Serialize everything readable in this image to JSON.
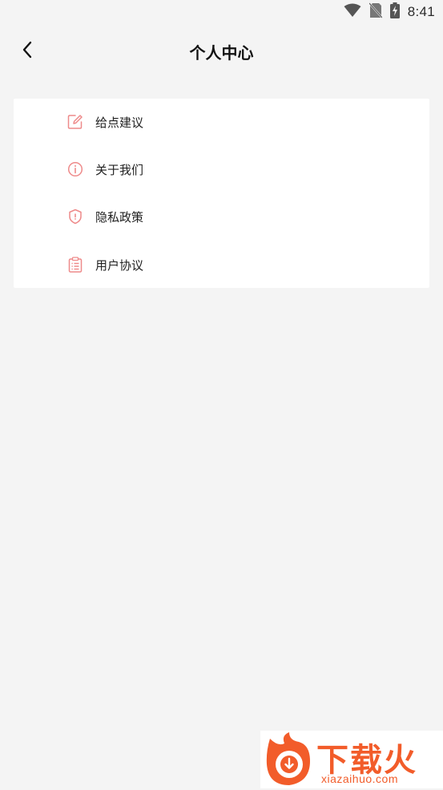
{
  "status_bar": {
    "time": "8:41",
    "icons": [
      "wifi-icon",
      "no-sim-icon",
      "battery-charging-icon"
    ]
  },
  "header": {
    "title": "个人中心",
    "back_icon": "chevron-left-icon"
  },
  "menu": {
    "items": [
      {
        "label": "给点建议",
        "icon": "edit-icon"
      },
      {
        "label": "关于我们",
        "icon": "info-icon"
      },
      {
        "label": "隐私政策",
        "icon": "shield-icon"
      },
      {
        "label": "用户协议",
        "icon": "clipboard-list-icon"
      }
    ]
  },
  "watermark": {
    "brand": "下载火",
    "domain": "xiazaihuo.com"
  },
  "colors": {
    "background": "#f4f4f4",
    "card": "#ffffff",
    "icon_accent": "#ee8a8a",
    "watermark_orange": "#f25c2a"
  }
}
